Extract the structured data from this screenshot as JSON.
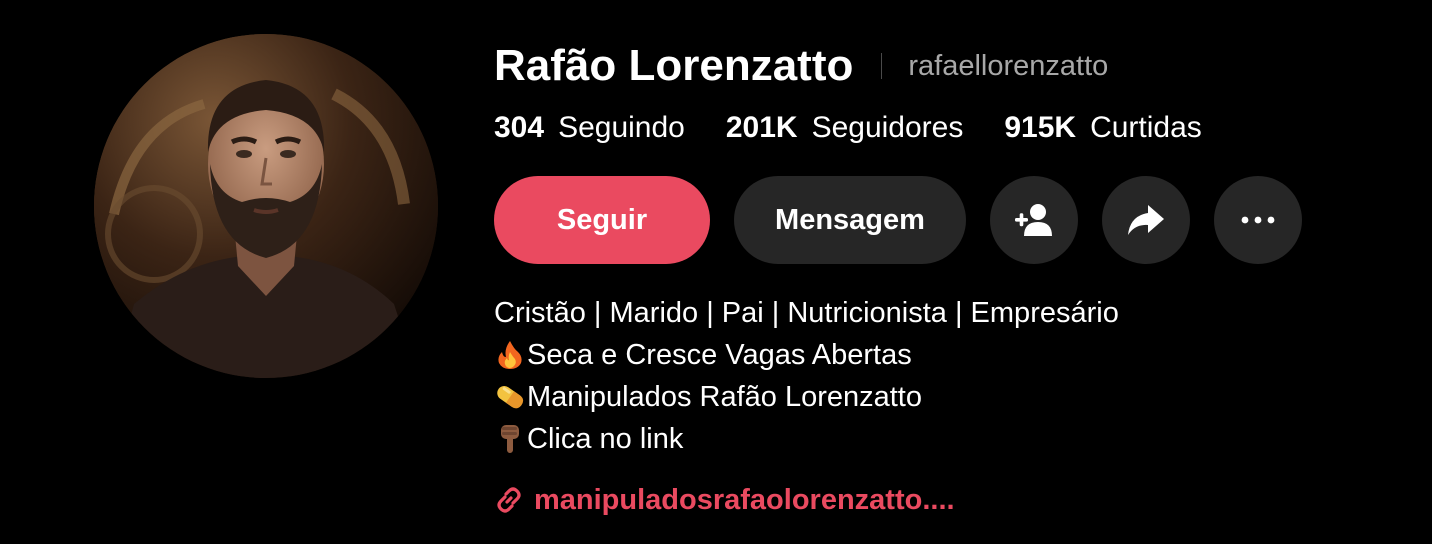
{
  "profile": {
    "display_name": "Rafão Lorenzatto",
    "username": "rafaellorenzatto",
    "avatar_icon": "avatar-photo"
  },
  "stats": [
    {
      "value": "304",
      "label": "Seguindo"
    },
    {
      "value": "201K",
      "label": "Seguidores"
    },
    {
      "value": "915K",
      "label": "Curtidas"
    }
  ],
  "actions": {
    "follow_label": "Seguir",
    "message_label": "Mensagem",
    "add_friend_icon": "add-user-icon",
    "share_icon": "share-icon",
    "more_icon": "more-icon"
  },
  "bio": {
    "line1": "Cristão | Marido | Pai | Nutricionista | Empresário",
    "line2": "Seca e Cresce Vagas Abertas",
    "line2_icon": "fire-emoji",
    "line3": "Manipulados Rafão Lorenzatto",
    "line3_icon": "pill-emoji",
    "line4": "Clica no link",
    "line4_icon": "pointing-down-emoji"
  },
  "link": {
    "text": "manipuladosrafaolorenzatto....",
    "icon": "link-icon"
  },
  "colors": {
    "background": "#000000",
    "accent": "#ea4a60",
    "button_dark": "#262626",
    "muted_text": "#a8a8a8"
  }
}
